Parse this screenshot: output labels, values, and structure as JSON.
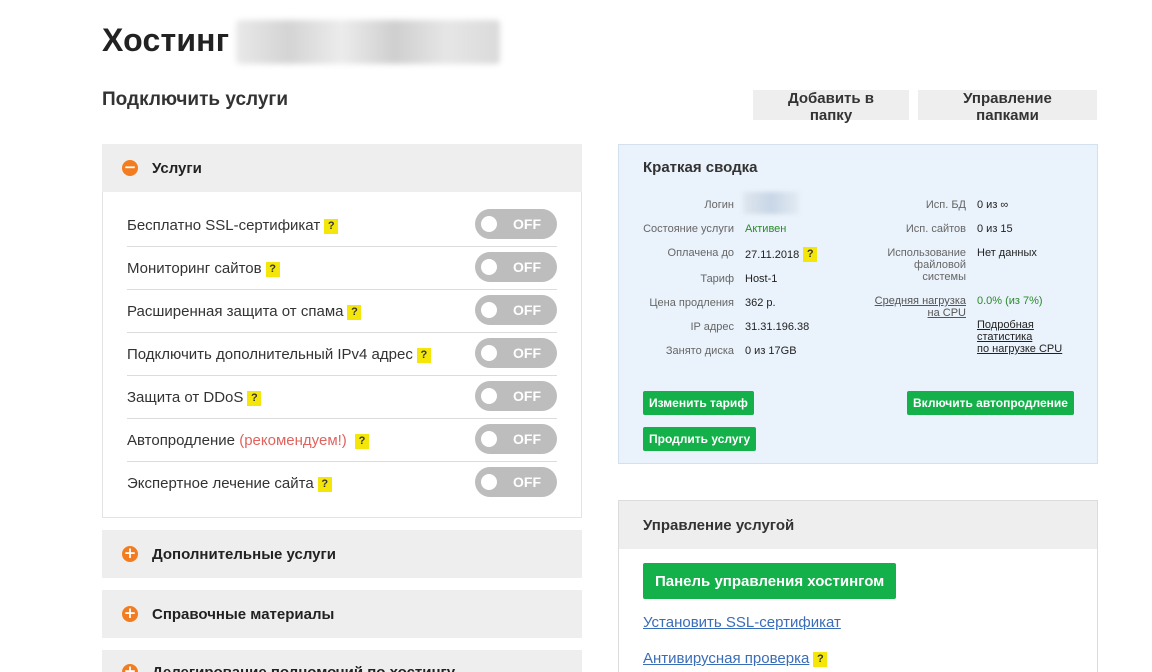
{
  "page": {
    "title": "Хостинг"
  },
  "section": {
    "title": "Подключить услуги"
  },
  "toolbar": {
    "add_folder": "Добавить в папку",
    "manage_folders": "Управление папками"
  },
  "accordion": {
    "services": {
      "title": "Услуги",
      "icon": "minus-circle-icon",
      "items": [
        {
          "label": "Бесплатно SSL-сертификат",
          "state": "OFF"
        },
        {
          "label": "Мониторинг сайтов",
          "state": "OFF"
        },
        {
          "label": "Расширенная защита от спама",
          "state": "OFF"
        },
        {
          "label": "Подключить дополнительный IPv4 адрес",
          "state": "OFF"
        },
        {
          "label": "Защита от DDoS",
          "state": "OFF"
        },
        {
          "label": "Автопродление",
          "note": "(рекомендуем!)",
          "state": "OFF"
        },
        {
          "label": "Экспертное лечение сайта",
          "state": "OFF"
        }
      ]
    },
    "extra": {
      "title": "Дополнительные услуги",
      "icon": "plus-circle-icon"
    },
    "reference": {
      "title": "Справочные материалы",
      "icon": "plus-circle-icon"
    },
    "partial": {
      "title": "Делегирование полномочий по хостингу",
      "icon": "plus-circle-icon"
    }
  },
  "help_mark": "?",
  "summary": {
    "title": "Краткая сводка",
    "left": [
      {
        "label": "Логин",
        "value": ""
      },
      {
        "label": "Состояние услуги",
        "value": "Активен"
      },
      {
        "label": "Оплачена до",
        "value": "27.11.2018"
      },
      {
        "label": "Тариф",
        "value": "Host-1"
      },
      {
        "label": "Цена продления",
        "value": "362 р."
      },
      {
        "label": "IP адрес",
        "value": "31.31.196.38"
      },
      {
        "label": "Занято диска",
        "value": "0 из 17GB"
      }
    ],
    "right": [
      {
        "label": "Исп. БД",
        "value": "0 из ∞"
      },
      {
        "label": "Исп. сайтов",
        "value": "0 из 15"
      },
      {
        "label_lines": [
          "Использование",
          "файловой",
          "системы"
        ],
        "value": "Нет данных"
      },
      {
        "label_lines": [
          "Средняя нагрузка",
          "на CPU"
        ],
        "value": "0.0% (из 7%)"
      }
    ],
    "stats_link_lines": [
      "Подробная",
      "статистика",
      "по нагрузке CPU"
    ],
    "buttons": {
      "change_tariff": "Изменить тариф",
      "enable_autorenew": "Включить автопродление",
      "renew": "Продлить услугу"
    }
  },
  "manage": {
    "title": "Управление услугой",
    "panel_button": "Панель управления хостингом",
    "links": [
      "Установить SSL-сертификат",
      "Антивирусная проверка"
    ]
  },
  "colors": {
    "accent_orange": "#f27c1f",
    "green": "#14b04a",
    "toggle_off": "#bdbdbd",
    "help_yellow": "#f5e60a"
  }
}
